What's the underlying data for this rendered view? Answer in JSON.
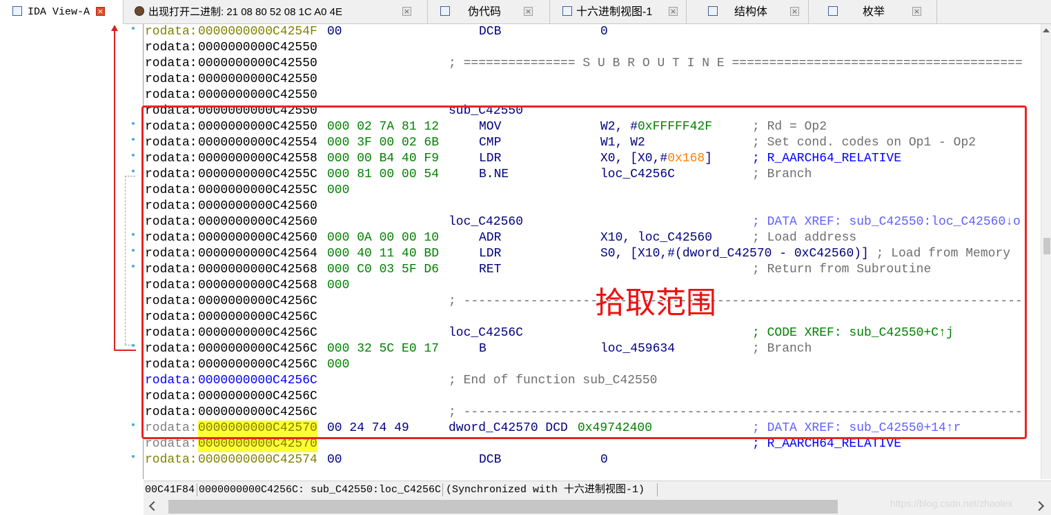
{
  "tabs": [
    {
      "label": "IDA View-A",
      "icon": "disassembly-view-icon",
      "close": "×",
      "active": true
    },
    {
      "label": "出现打开二进制: 21 08 80 52 08 1C A0 4E",
      "icon": "user-avatar-icon",
      "close": "×",
      "active": false
    },
    {
      "label": "伪代码",
      "icon": "pseudocode-icon",
      "close": "×",
      "active": false
    },
    {
      "label": "十六进制视图-1",
      "icon": "hex-view-icon",
      "close": "×",
      "active": false
    },
    {
      "label": "结构体",
      "icon": "structures-icon",
      "close": "×",
      "active": false
    },
    {
      "label": "枚举",
      "icon": "enums-icon",
      "close": "×",
      "active": false
    }
  ],
  "lines": [
    {
      "seg": "rodata:",
      "addr": "0000000000C4254F",
      "bytes": "00",
      "mnem": "DCB",
      "ops": "0"
    },
    {
      "seg": "rodata:",
      "addr": "0000000000C42550"
    },
    {
      "seg": "rodata:",
      "addr": "0000000000C42550",
      "label": "; =============== S U B R O U T I N E ======================================="
    },
    {
      "seg": "rodata:",
      "addr": "0000000000C42550"
    },
    {
      "seg": "rodata:",
      "addr": "0000000000C42550"
    },
    {
      "seg": "rodata:",
      "addr": "0000000000C42550",
      "label": "sub_C42550"
    },
    {
      "seg": "rodata:",
      "addr": "0000000000C42550",
      "bytes": "000 02 7A 81 12",
      "mnem": "MOV",
      "ops": "W2, #",
      "ops_imm": "0xFFFFF42F",
      "cmt": "; Rd = Op2"
    },
    {
      "seg": "rodata:",
      "addr": "0000000000C42554",
      "bytes": "000 3F 00 02 6B",
      "mnem": "CMP",
      "ops": "W1, W2",
      "cmt": "; Set cond. codes on Op1 - Op2"
    },
    {
      "seg": "rodata:",
      "addr": "0000000000C42558",
      "bytes": "000 00 B4 40 F9",
      "mnem": "LDR",
      "ops": "X0, [X0,#",
      "ops_imm": "0x168",
      "ops_tail": "]",
      "cmt": "; R_AARCH64_RELATIVE"
    },
    {
      "seg": "rodata:",
      "addr": "0000000000C4255C",
      "bytes": "000 81 00 00 54",
      "mnem": "B.NE",
      "ops": "loc_C4256C",
      "cmt": "; Branch"
    },
    {
      "seg": "rodata:",
      "addr": "0000000000C4255C",
      "bytes": "000"
    },
    {
      "seg": "rodata:",
      "addr": "0000000000C42560"
    },
    {
      "seg": "rodata:",
      "addr": "0000000000C42560",
      "label": "loc_C42560",
      "cmt": "; DATA XREF: sub_C42550:loc_C42560↓o"
    },
    {
      "seg": "rodata:",
      "addr": "0000000000C42560",
      "bytes": "000 0A 00 00 10",
      "mnem": "ADR",
      "ops": "X10, loc_C42560",
      "cmt": "; Load address"
    },
    {
      "seg": "rodata:",
      "addr": "0000000000C42564",
      "bytes": "000 40 11 40 BD",
      "mnem": "LDR",
      "ops": "S0, [X10,#(dword_C42570 - 0xC42560)] ",
      "cmt_inline": "; Load from Memory"
    },
    {
      "seg": "rodata:",
      "addr": "0000000000C42568",
      "bytes": "000 C0 03 5F D6",
      "mnem": "RET",
      "cmt": "; Return from Subroutine"
    },
    {
      "seg": "rodata:",
      "addr": "0000000000C42568",
      "bytes": "000"
    },
    {
      "seg": "rodata:",
      "addr": "0000000000C4256C",
      "label": "; ---------------------------------------------------------------------------"
    },
    {
      "seg": "rodata:",
      "addr": "0000000000C4256C"
    },
    {
      "seg": "rodata:",
      "addr": "0000000000C4256C",
      "label": "loc_C4256C",
      "cmt": "; CODE XREF: sub_C42550+C↑j"
    },
    {
      "seg": "rodata:",
      "addr": "0000000000C4256C",
      "bytes": "000 32 5C E0 17",
      "mnem": "B",
      "ops": "loc_459634",
      "cmt": "; Branch"
    },
    {
      "seg": "rodata:",
      "addr": "0000000000C4256C",
      "bytes": "000"
    },
    {
      "seg": "rodata:",
      "addr": "0000000000C4256C",
      "label": "; End of function sub_C42550"
    },
    {
      "seg": "rodata:",
      "addr": "0000000000C4256C"
    },
    {
      "seg": "rodata:",
      "addr": "0000000000C4256C",
      "label": "; ---------------------------------------------------------------------------"
    },
    {
      "seg": "rodata:",
      "addr": "0000000000C42570",
      "bytes": "00 24 74 49",
      "label": "dword_C42570 DCD ",
      "label_val": "0x49742400",
      "cmt": "; DATA XREF: sub_C42550+14↑r"
    },
    {
      "seg": "rodata:",
      "addr": "0000000000C42570",
      "cmt": "; R_AARCH64_RELATIVE"
    },
    {
      "seg": "rodata:",
      "addr": "0000000000C42574",
      "bytes": "00",
      "mnem": "DCB",
      "ops": "0"
    }
  ],
  "annotation": "拾取范围",
  "status": {
    "offset": "00C41F84",
    "location": "0000000000C4256C: sub_C42550:loc_C4256C",
    "sync": "(Synchronized with 十六进制视图-1)"
  },
  "watermark": "https://blog.csdn.net/zhaolex",
  "colors": {
    "annotation_red": "#ee2222",
    "address_highlight": "#ffff33",
    "instruction_blue": "#000080",
    "bytes_green": "#008000",
    "segment_olive": "#808000"
  }
}
